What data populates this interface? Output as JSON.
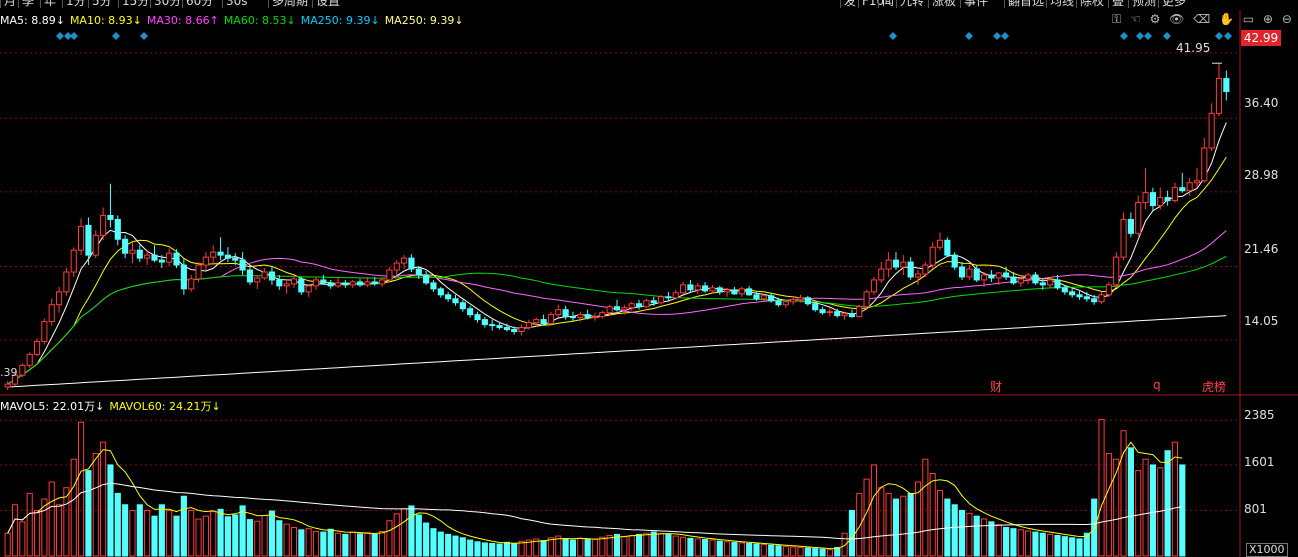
{
  "toolbar": {
    "items": [
      "月",
      "季",
      "年",
      "1分",
      "5分",
      "15分",
      "30分",
      "60分",
      "30s",
      "多周期",
      "设置"
    ],
    "right_items": [
      "发",
      "F10",
      "闻",
      "九转",
      "涨板",
      "事件",
      "翻首选",
      "均线",
      "除权",
      "叠",
      "预测",
      "更多"
    ]
  },
  "ma_legend": [
    {
      "label": "MA5: 8.89↓",
      "color": "#ffffff"
    },
    {
      "label": "MA10: 8.93↓",
      "color": "#ffff00"
    },
    {
      "label": "MA30: 8.66↑",
      "color": "#ff44ff"
    },
    {
      "label": "MA60: 8.53↓",
      "color": "#00dd00"
    },
    {
      "label": "MA250: 9.39↓",
      "color": "#00ccff"
    },
    {
      "label": "MA250: 9.39↓",
      "color": "#ffff88"
    }
  ],
  "vol_legend": [
    {
      "label": "MAVOL5: 22.01万↓",
      "color": "#ffffff"
    },
    {
      "label": "MAVOL60: 24.21万↓",
      "color": "#ffff00"
    }
  ],
  "price_axis": {
    "ticks": [
      "42.99",
      "36.40",
      "28.98",
      "21.46",
      "14.05"
    ],
    "current": "42.99",
    "peak_label": "41.95",
    "left_cut": ".39"
  },
  "volume_axis": {
    "ticks": [
      "2385",
      "1601",
      "801"
    ],
    "unit": "X1000"
  },
  "events": [
    {
      "label": "财",
      "color": "#ff4444"
    },
    {
      "label": "q",
      "color": "#ff4444"
    },
    {
      "label": "龙虎榜",
      "color": "#ff4444"
    }
  ],
  "colors": {
    "up": "#ff3b3b",
    "down": "#54ffff",
    "grid": "#7a1010"
  },
  "chart_data": {
    "type": "candlestick",
    "price_ylim": [
      8.5,
      45.5
    ],
    "volume_ylim": [
      0,
      2600
    ],
    "ohlc": [
      [
        9.3,
        9.9,
        9,
        9.6
      ],
      [
        9.6,
        10.7,
        9.4,
        10.5
      ],
      [
        10.5,
        11.7,
        10.3,
        11.5
      ],
      [
        11.5,
        12.8,
        11.2,
        12.6
      ],
      [
        12.6,
        14.2,
        12.4,
        13.9
      ],
      [
        13.9,
        16.2,
        13.6,
        15.9
      ],
      [
        15.9,
        18.2,
        15.5,
        17.6
      ],
      [
        17.6,
        19.4,
        16.8,
        18.9
      ],
      [
        18.9,
        21.3,
        18.5,
        20.9
      ],
      [
        20.9,
        23.4,
        20.4,
        23.1
      ],
      [
        23.1,
        26.3,
        22.6,
        25.5
      ],
      [
        25.6,
        26.4,
        21.6,
        22.6
      ],
      [
        22.6,
        25.1,
        22.3,
        24.6
      ],
      [
        24.6,
        27.4,
        24.1,
        26.6
      ],
      [
        26.6,
        29.8,
        25.4,
        26.2
      ],
      [
        26.2,
        26.6,
        23.6,
        24.2
      ],
      [
        24.2,
        24.6,
        22.3,
        22.8
      ],
      [
        22.8,
        23.9,
        21.8,
        23.1
      ],
      [
        23.1,
        23.6,
        21.9,
        22.3
      ],
      [
        22.3,
        23.1,
        21.6,
        22.6
      ],
      [
        22.6,
        23.6,
        21.9,
        22.1
      ],
      [
        22.1,
        22.6,
        21.3,
        21.9
      ],
      [
        21.9,
        23.3,
        21.5,
        22.8
      ],
      [
        22.8,
        23.2,
        21.3,
        21.6
      ],
      [
        21.6,
        22.3,
        18.6,
        19.2
      ],
      [
        19.2,
        20.6,
        18.9,
        20.2
      ],
      [
        20.2,
        21.9,
        19.9,
        21.6
      ],
      [
        21.6,
        22.9,
        21.1,
        22.4
      ],
      [
        22.4,
        23.6,
        21.6,
        22.9
      ],
      [
        22.9,
        24.4,
        22.1,
        22.6
      ],
      [
        22.6,
        23.4,
        21.9,
        22.3
      ],
      [
        22.3,
        22.8,
        21.6,
        22.1
      ],
      [
        22.1,
        22.9,
        20.6,
        21.1
      ],
      [
        21.1,
        21.6,
        19.6,
        19.9
      ],
      [
        19.9,
        20.6,
        19.2,
        20.3
      ],
      [
        20.3,
        21.3,
        20.1,
        20.9
      ],
      [
        20.9,
        21.4,
        19.6,
        20.1
      ],
      [
        20.1,
        20.6,
        19.1,
        19.5
      ],
      [
        19.5,
        20.1,
        18.7,
        19.7
      ],
      [
        19.7,
        20.6,
        19.3,
        20.2
      ],
      [
        20.2,
        20.4,
        18.6,
        18.9
      ],
      [
        18.9,
        19.7,
        18.4,
        19.5
      ],
      [
        19.5,
        20.4,
        19.1,
        20.1
      ],
      [
        20.1,
        20.6,
        19.6,
        19.8
      ],
      [
        19.8,
        20.1,
        19.2,
        19.5
      ],
      [
        19.5,
        20.3,
        19.3,
        19.8
      ],
      [
        19.8,
        20.1,
        19.3,
        19.6
      ],
      [
        19.6,
        20.1,
        19.3,
        19.9
      ],
      [
        19.9,
        20.2,
        19.4,
        19.6
      ],
      [
        19.6,
        20.4,
        19.4,
        19.9
      ],
      [
        19.9,
        20.4,
        19.5,
        19.7
      ],
      [
        19.7,
        20.3,
        19.4,
        20.1
      ],
      [
        20.1,
        21.4,
        20,
        21.1
      ],
      [
        21.1,
        22.1,
        20.6,
        21.8
      ],
      [
        21.8,
        22.6,
        21.2,
        22.3
      ],
      [
        22.3,
        22.7,
        20.9,
        21.2
      ],
      [
        21.2,
        21.5,
        20.2,
        20.6
      ],
      [
        20.6,
        21,
        19.6,
        19.8
      ],
      [
        19.8,
        20.1,
        18.9,
        19.2
      ],
      [
        19.2,
        19.4,
        18.3,
        18.6
      ],
      [
        18.6,
        18.9,
        17.9,
        18.2
      ],
      [
        18.2,
        18.6,
        17.5,
        17.8
      ],
      [
        17.8,
        18.1,
        16.9,
        17.2
      ],
      [
        17.2,
        17.5,
        16.3,
        16.6
      ],
      [
        16.6,
        16.9,
        15.8,
        16.1
      ],
      [
        16.1,
        16.4,
        15.3,
        15.6
      ],
      [
        15.6,
        16.1,
        15,
        15.5
      ],
      [
        15.5,
        15.9,
        15.1,
        15.3
      ],
      [
        15.3,
        15.7,
        14.9,
        15.1
      ],
      [
        15.1,
        15.4,
        14.6,
        14.9
      ],
      [
        14.9,
        15.6,
        14.5,
        15.3
      ],
      [
        15.3,
        16.1,
        15.1,
        15.8
      ],
      [
        15.8,
        16.3,
        15.4,
        16.1
      ],
      [
        16.1,
        16.6,
        15.5,
        15.7
      ],
      [
        15.7,
        16.9,
        15.6,
        16.6
      ],
      [
        16.6,
        17.6,
        16.3,
        17.1
      ],
      [
        17.1,
        17.5,
        16.1,
        16.4
      ],
      [
        16.4,
        16.9,
        15.9,
        16.3
      ],
      [
        16.3,
        16.9,
        15.9,
        16.6
      ],
      [
        16.6,
        17.1,
        16.1,
        16.3
      ],
      [
        16.3,
        16.8,
        16,
        16.4
      ],
      [
        16.4,
        17,
        16.2,
        16.8
      ],
      [
        16.8,
        17.6,
        16.5,
        17.4
      ],
      [
        17.4,
        18.1,
        16.9,
        17.1
      ],
      [
        17.1,
        17.6,
        16.6,
        17.3
      ],
      [
        17.3,
        17.9,
        17,
        17.7
      ],
      [
        17.7,
        18.1,
        17.1,
        17.4
      ],
      [
        17.4,
        18.2,
        17.3,
        18.0
      ],
      [
        18.0,
        18.4,
        17.5,
        17.8
      ],
      [
        17.8,
        18.6,
        17.6,
        18.4
      ],
      [
        18.4,
        18.9,
        18.0,
        18.3
      ],
      [
        18.3,
        19.1,
        18.1,
        18.8
      ],
      [
        18.8,
        19.9,
        18.6,
        19.6
      ],
      [
        19.6,
        20.1,
        18.9,
        19.1
      ],
      [
        19.1,
        19.8,
        18.7,
        19.5
      ],
      [
        19.5,
        19.9,
        18.8,
        19.0
      ],
      [
        19.0,
        19.6,
        18.7,
        19.3
      ],
      [
        19.3,
        19.5,
        18.6,
        18.9
      ],
      [
        18.9,
        19.3,
        18.4,
        19.1
      ],
      [
        19.1,
        19.4,
        18.6,
        18.7
      ],
      [
        18.7,
        19.4,
        18.4,
        19.2
      ],
      [
        19.2,
        19.5,
        18.5,
        18.6
      ],
      [
        18.6,
        18.9,
        18.0,
        18.2
      ],
      [
        18.2,
        18.7,
        17.9,
        18.5
      ],
      [
        18.5,
        18.8,
        17.8,
        18.0
      ],
      [
        18.0,
        18.3,
        17.4,
        17.6
      ],
      [
        17.6,
        18.1,
        17.3,
        17.9
      ],
      [
        17.9,
        18.4,
        17.6,
        18.1
      ],
      [
        18.1,
        18.6,
        17.8,
        18.3
      ],
      [
        18.3,
        18.5,
        17.5,
        17.7
      ],
      [
        17.7,
        17.9,
        16.9,
        17.1
      ],
      [
        17.1,
        17.4,
        16.6,
        16.8
      ],
      [
        16.8,
        17.3,
        16.4,
        16.9
      ],
      [
        16.9,
        17.2,
        16.3,
        16.5
      ],
      [
        16.5,
        16.9,
        16.1,
        16.7
      ],
      [
        16.7,
        17.1,
        16.3,
        16.4
      ],
      [
        16.4,
        17.6,
        16.3,
        17.4
      ],
      [
        17.4,
        19.1,
        17.2,
        18.9
      ],
      [
        18.9,
        20.4,
        18.6,
        20.1
      ],
      [
        20.1,
        21.9,
        19.8,
        21.2
      ],
      [
        21.2,
        22.9,
        20.4,
        22.1
      ],
      [
        22.1,
        22.9,
        21.1,
        21.4
      ],
      [
        21.4,
        22.6,
        20.6,
        21.9
      ],
      [
        21.9,
        22.4,
        20.1,
        20.4
      ],
      [
        20.4,
        21.1,
        19.6,
        20.7
      ],
      [
        20.7,
        21.9,
        20.4,
        21.6
      ],
      [
        21.6,
        23.9,
        21.2,
        23.4
      ],
      [
        23.4,
        24.9,
        23.1,
        24.1
      ],
      [
        24.1,
        24.4,
        22.4,
        22.6
      ],
      [
        22.6,
        22.9,
        21.1,
        21.4
      ],
      [
        21.4,
        21.9,
        20.1,
        20.4
      ],
      [
        20.4,
        21.6,
        20.1,
        21.2
      ],
      [
        21.2,
        21.6,
        19.9,
        20.1
      ],
      [
        20.1,
        20.9,
        19.4,
        20.6
      ],
      [
        20.6,
        21.1,
        19.9,
        20.3
      ],
      [
        20.3,
        20.9,
        19.6,
        20.8
      ],
      [
        20.8,
        21.4,
        20.1,
        20.4
      ],
      [
        20.4,
        20.9,
        19.6,
        19.8
      ],
      [
        19.8,
        20.6,
        19.4,
        20.2
      ],
      [
        20.2,
        20.8,
        19.7,
        20.6
      ],
      [
        20.6,
        20.9,
        19.6,
        19.8
      ],
      [
        19.8,
        20.3,
        19.1,
        19.6
      ],
      [
        19.6,
        20.4,
        19.3,
        20.1
      ],
      [
        20.1,
        20.6,
        19.1,
        19.3
      ],
      [
        19.3,
        19.6,
        18.6,
        18.9
      ],
      [
        18.9,
        19.3,
        18.3,
        18.6
      ],
      [
        18.6,
        19.1,
        18.1,
        18.4
      ],
      [
        18.4,
        18.9,
        17.9,
        18.2
      ],
      [
        18.2,
        18.6,
        17.6,
        17.9
      ],
      [
        17.9,
        18.9,
        17.7,
        18.6
      ],
      [
        18.6,
        19.9,
        18.4,
        19.6
      ],
      [
        19.6,
        22.9,
        19.3,
        22.4
      ],
      [
        22.4,
        26.9,
        22.1,
        26.2
      ],
      [
        26.2,
        26.9,
        24.4,
        24.8
      ],
      [
        24.8,
        28.6,
        24.5,
        27.9
      ],
      [
        27.9,
        31.4,
        27.2,
        28.9
      ],
      [
        28.9,
        29.4,
        27.1,
        27.6
      ],
      [
        27.6,
        29.4,
        27.2,
        28.4
      ],
      [
        28.4,
        29.1,
        27.6,
        28.1
      ],
      [
        28.1,
        29.9,
        27.9,
        29.4
      ],
      [
        29.4,
        30.9,
        28.9,
        29.1
      ],
      [
        29.1,
        30.4,
        28.6,
        29.9
      ],
      [
        29.9,
        31.4,
        29.4,
        30.1
      ],
      [
        30.1,
        34.4,
        29.9,
        33.4
      ],
      [
        33.4,
        37.9,
        33.1,
        36.9
      ],
      [
        36.9,
        41.95,
        36.6,
        40.4
      ],
      [
        40.4,
        41.2,
        38.2,
        39.1
      ]
    ],
    "volume": [
      400,
      900,
      600,
      1100,
      800,
      1000,
      1300,
      900,
      1200,
      1700,
      2350,
      1500,
      1800,
      2000,
      1600,
      1100,
      900,
      800,
      900,
      800,
      700,
      900,
      800,
      700,
      1050,
      800,
      650,
      700,
      780,
      820,
      690,
      720,
      880,
      640,
      610,
      710,
      790,
      620,
      560,
      500,
      460,
      480,
      430,
      420,
      470,
      400,
      380,
      420,
      390,
      410,
      380,
      430,
      620,
      740,
      830,
      880,
      720,
      580,
      480,
      420,
      380,
      350,
      320,
      280,
      250,
      230,
      220,
      210,
      240,
      220,
      260,
      280,
      300,
      270,
      320,
      350,
      300,
      280,
      310,
      290,
      300,
      330,
      360,
      380,
      340,
      360,
      380,
      400,
      420,
      390,
      380,
      350,
      330,
      310,
      300,
      290,
      280,
      260,
      250,
      240,
      230,
      220,
      210,
      200,
      190,
      180,
      170,
      160,
      150,
      140,
      130,
      120,
      110,
      150,
      400,
      800,
      1100,
      1350,
      1600,
      1200,
      1100,
      1000,
      1050,
      1100,
      1300,
      1700,
      1450,
      1150,
      1000,
      900,
      800,
      750,
      700,
      650,
      600,
      550,
      500,
      480,
      460,
      440,
      420,
      400,
      380,
      360,
      340,
      320,
      300,
      400,
      1000,
      2400,
      1800,
      1700,
      2200,
      1900,
      1500,
      1700,
      1600,
      1550,
      1850,
      2000,
      1600
    ]
  }
}
